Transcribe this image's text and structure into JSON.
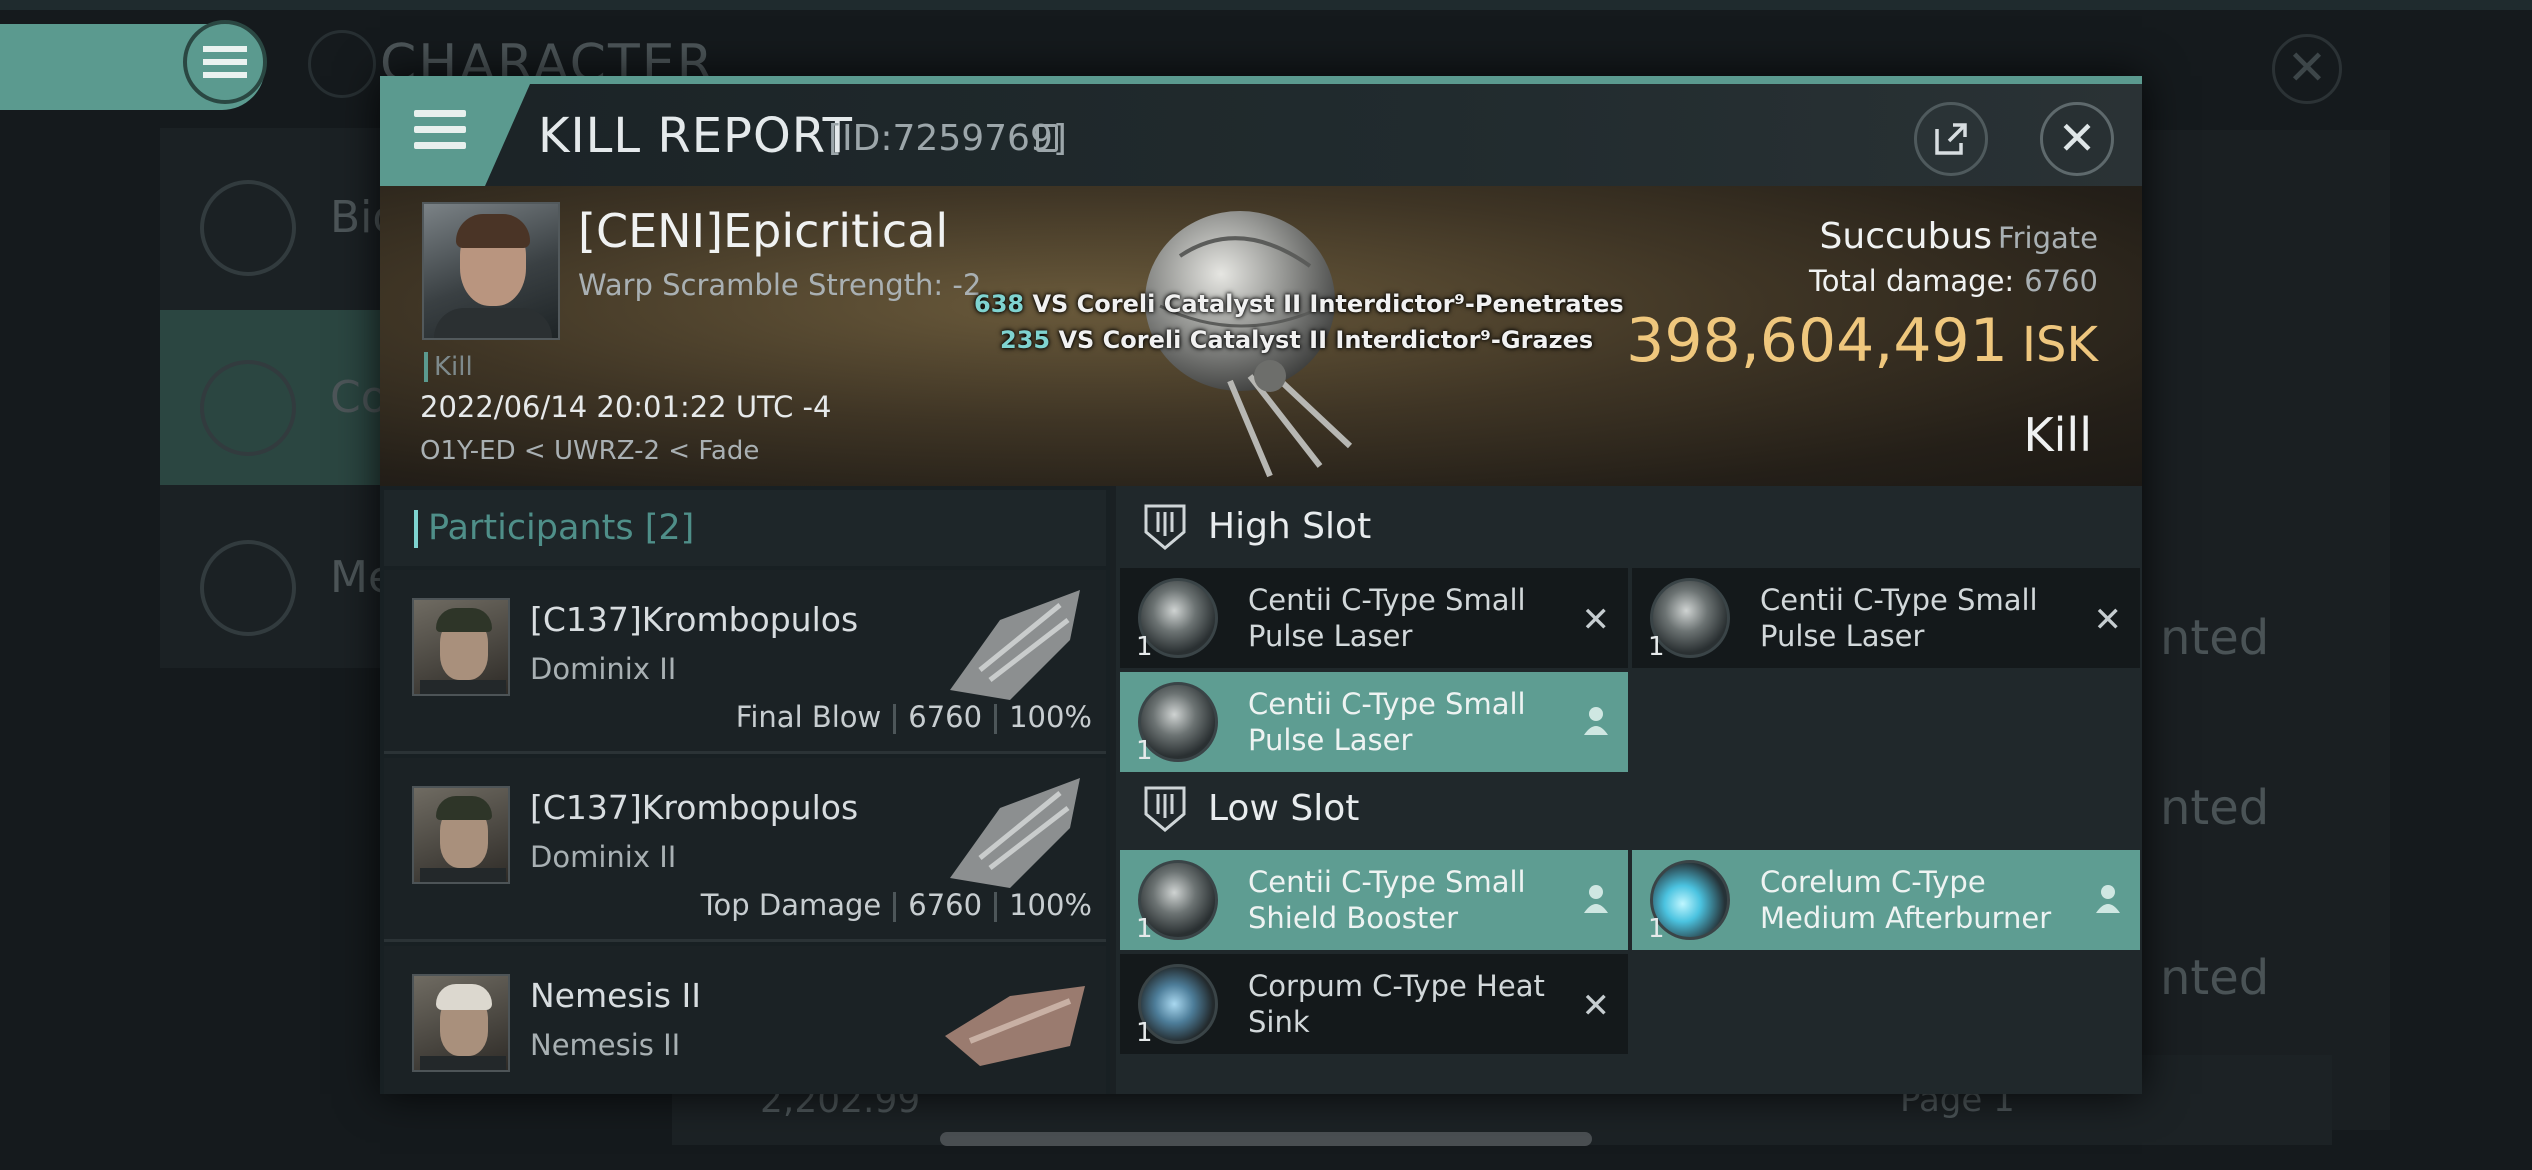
{
  "background": {
    "title": "CHARACTER",
    "left_items": [
      "Bio",
      "Co",
      "Me"
    ],
    "right_texts": [
      "nted",
      "nted",
      "nted"
    ],
    "bottom_value": "2,202.99",
    "page_label": "Page 1"
  },
  "modal": {
    "title": "KILL REPORT",
    "report_id": "[ID:7259769]",
    "victim": {
      "name": "[CENI]Epicritical",
      "warp_scramble": "Warp Scramble Strength: -2",
      "tag": "Kill",
      "datetime": "2022/06/14 20:01:22 UTC -4",
      "location": "O1Y-ED < UWRZ-2 < Fade"
    },
    "hits": [
      {
        "value": "638",
        "text": "VS Coreli Catalyst II Interdictor⁹-Penetrates"
      },
      {
        "value": "235",
        "text": "VS Coreli Catalyst II Interdictor⁹-Grazes"
      }
    ],
    "ship": {
      "name": "Succubus",
      "class": "Frigate"
    },
    "total_damage_label": "Total damage:",
    "total_damage": "6760",
    "isk_value": "398,604,491",
    "isk_unit": "ISK",
    "result": "Kill",
    "participants_label": "Participants [2]",
    "participants": [
      {
        "name": "[C137]Krombopulos",
        "ship": "Dominix II",
        "role": "Final Blow",
        "damage": "6760",
        "percent": "100%"
      },
      {
        "name": "[C137]Krombopulos",
        "ship": "Dominix II",
        "role": "Top Damage",
        "damage": "6760",
        "percent": "100%"
      },
      {
        "name": "Nemesis II",
        "ship": "Nemesis II"
      }
    ],
    "high_slot_label": "High Slot",
    "low_slot_label": "Low Slot",
    "high_slot": [
      {
        "qty": "1",
        "name": "Centii C-Type Small Pulse Laser",
        "status": "destroyed"
      },
      {
        "qty": "1",
        "name": "Centii C-Type Small Pulse Laser",
        "status": "destroyed"
      },
      {
        "qty": "1",
        "name": "Centii C-Type Small Pulse Laser",
        "status": "dropped"
      }
    ],
    "low_slot": [
      {
        "qty": "1",
        "name": "Centii C-Type Small Shield Booster",
        "status": "dropped"
      },
      {
        "qty": "1",
        "name": "Corelum C-Type Medium Afterburner",
        "status": "dropped"
      },
      {
        "qty": "1",
        "name": "Corpum C-Type Heat Sink",
        "status": "destroyed"
      }
    ]
  },
  "colors": {
    "accent": "#5b9a8f",
    "isk_gold": "#efc77d",
    "hit_number": "#7fd3d0"
  }
}
